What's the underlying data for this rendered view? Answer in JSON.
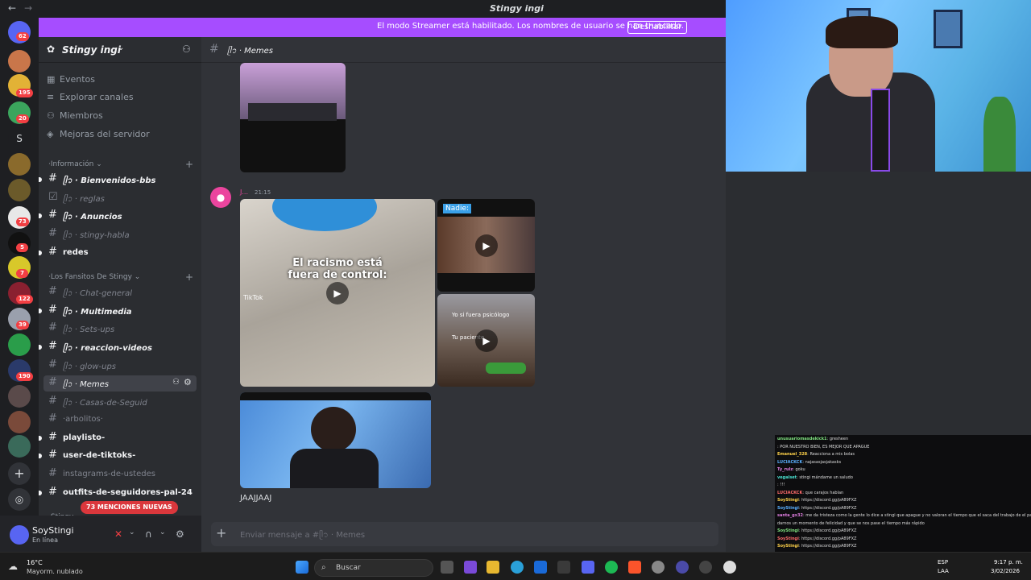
{
  "window": {
    "title": "Stingy ingi"
  },
  "banner": {
    "message": "El modo Streamer está habilitado. Los nombres de usuario se han truncado.",
    "button": "Deshabilitar"
  },
  "server_rail": {
    "badges": [
      "62",
      "195",
      "20",
      "73",
      "5",
      "7",
      "122",
      "39",
      "190"
    ],
    "letter_server": "S"
  },
  "sidebar": {
    "server_name": "Stingy ingi",
    "items": [
      {
        "label": "Eventos",
        "icon": "calendar-icon"
      },
      {
        "label": "Explorar canales",
        "icon": "browse-icon"
      },
      {
        "label": "Miembros",
        "icon": "members-icon"
      },
      {
        "label": "Mejoras del servidor",
        "icon": "boost-icon"
      }
    ],
    "categories": [
      {
        "label": "·Información"
      },
      {
        "label": "·Los Fansitos De Stingy"
      },
      {
        "label": "·Stingy"
      }
    ],
    "channels": [
      {
        "label": "ᥫ᭡ · Bienvenidos-bbs",
        "unread": true
      },
      {
        "label": "ᥫ᭡ · reglas",
        "unread": false
      },
      {
        "label": "ᥫ᭡ · Anuncios",
        "unread": true
      },
      {
        "label": "ᥫ᭡ · stingy-habla",
        "unread": false
      },
      {
        "label": "redes",
        "unread": true
      },
      {
        "label": "ᥫ᭡ · Chat-general",
        "unread": false
      },
      {
        "label": "ᥫ᭡ · Multimedia",
        "unread": true
      },
      {
        "label": "ᥫ᭡ · Sets-ups",
        "unread": false
      },
      {
        "label": "ᥫ᭡ · reaccion-videos",
        "unread": true
      },
      {
        "label": "ᥫ᭡ · glow-ups",
        "unread": false
      },
      {
        "label": "ᥫ᭡ · Memes",
        "unread": false,
        "selected": true
      },
      {
        "label": "ᥫ᭡ · Casas-de-Seguid",
        "unread": false
      },
      {
        "label": "·arbolitos·",
        "unread": false
      },
      {
        "label": "playlisto-",
        "unread": true
      },
      {
        "label": "user-de-tiktoks-",
        "unread": true
      },
      {
        "label": "instagrams-de-ustedes",
        "unread": false
      },
      {
        "label": "outfits-de-seguidores-pal-24",
        "unread": true
      }
    ],
    "mentions_pill": "73 MENCIONES NUEVAS"
  },
  "user_panel": {
    "username": "SoyStingi",
    "status": "En línea"
  },
  "channel_header": {
    "name": "ᥫ᭡ · Memes"
  },
  "message": {
    "author": "J...",
    "time": "21:15",
    "overlay_text": "El racismo está fuera de control:",
    "tag": "Nadie:",
    "caption1": "Yo si fuera psicólogo",
    "caption2": "Tu paciente",
    "watermark": "TikTok",
    "text": "JAAJJAAJ"
  },
  "composer": {
    "placeholder": "Enviar mensaje a #ᥫ᭡ · Memes"
  },
  "stream_chat": [
    {
      "user": "unusuariomasdekick1",
      "text": ": gresheen"
    },
    {
      "user": "",
      "text": ": POR NUESTRO BIEN, ES MEJOR QUE APAGUE"
    },
    {
      "user": "Emanuel_328",
      "text": ": Reacciona a mis bolas"
    },
    {
      "user": "LUCIACKCK",
      "text": ": najasasjasjakasks"
    },
    {
      "user": "Ty_rulz",
      "text": ": goku"
    },
    {
      "user": "vegalset",
      "text": ": stingi mándame un saludo"
    },
    {
      "user": "",
      "text": ": !!!"
    },
    {
      "user": "LUCIACKCK",
      "text": ": que carajos hablan"
    },
    {
      "user": "SoyStingi",
      "text": ": https://discord.gg/pA89FXZ"
    },
    {
      "user": "SoyStingi",
      "text": ": https://discord.gg/pA89FXZ"
    },
    {
      "user": "santa_gx32",
      "text": ": me da tristeza como la gente lo dice a stingi que apague y no valoran el tiempo que el saca del trabajo de el para poder"
    },
    {
      "user": "",
      "text": "darnos un momento de felicidad y que se nos pase el tiempo más rápido"
    },
    {
      "user": "SoyStingi",
      "text": ": https://discord.gg/pA89FXZ"
    },
    {
      "user": "SoyStingi",
      "text": ": https://discord.gg/pA89FXZ"
    },
    {
      "user": "SoyStingi",
      "text": ": https://discord.gg/pA89FXZ"
    },
    {
      "user": "SoyStingi",
      "text": ": https://discord.gg/pA89FXZ"
    },
    {
      "user": "SoyStingi",
      "text": ": https://discord.gg/pA89FXZ"
    },
    {
      "user": "SoyStingi",
      "text": ": https://discord.gg/pA89FXZ"
    }
  ],
  "taskbar": {
    "weather_temp": "16°C",
    "weather_desc": "Mayorm. nublado",
    "search": "Buscar",
    "lang": "ESP",
    "lang2": "LAA",
    "time": "9:17 p. m.",
    "date": "3/02/2026"
  },
  "colors": {
    "accent": "#a64dff",
    "discord": "#5865f2",
    "badge": "#f23f43"
  }
}
